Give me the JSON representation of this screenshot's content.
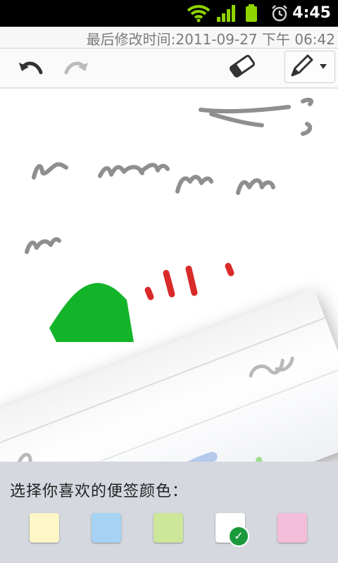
{
  "status_bar": {
    "time": "4:45",
    "icons": [
      "wifi-icon",
      "signal-icon",
      "battery-icon",
      "alarm-icon"
    ]
  },
  "note": {
    "timestamp": "最后修改时间:2011-09-27 下午 06:42"
  },
  "toolbar": {
    "undo": "undo-icon",
    "redo": "redo-icon",
    "eraser": "eraser-icon",
    "pen": "pen-icon",
    "dropdown": "caret-down-icon"
  },
  "color_picker": {
    "label": "选择你喜欢的便签颜色：",
    "colors": [
      {
        "name": "yellow",
        "hex": "#fdf7c8",
        "selected": false
      },
      {
        "name": "blue",
        "hex": "#a6d3f3",
        "selected": false
      },
      {
        "name": "green",
        "hex": "#cde79a",
        "selected": false
      },
      {
        "name": "white",
        "hex": "#ffffff",
        "selected": true
      },
      {
        "name": "pink",
        "hex": "#f3bcd9",
        "selected": false
      }
    ]
  }
}
